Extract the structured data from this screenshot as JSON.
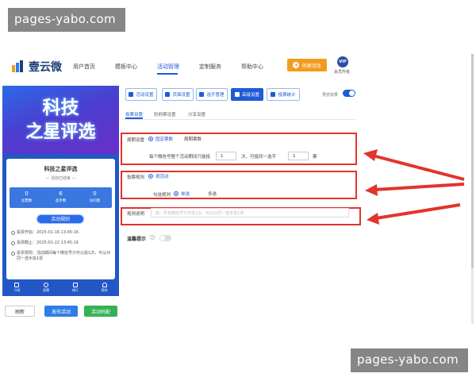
{
  "watermark": "pages-yabo.com",
  "nav": {
    "logo": "壹云微",
    "items": [
      "用户首页",
      "模板中心",
      "活动管理",
      "定制服务",
      "帮助中心"
    ],
    "active_index": 2,
    "create_button": "创建活动",
    "vip_badge": "VIP",
    "vip_label": "会员升级"
  },
  "preview": {
    "banner_line1": "科技",
    "banner_line2": "之星评选",
    "title": "科技之星评选",
    "status": "— 活动已结束 —",
    "stats": [
      {
        "num": "0",
        "label": "总票数"
      },
      {
        "num": "6",
        "label": "选手数"
      },
      {
        "num": "0",
        "label": "访问量"
      }
    ],
    "rules_button": "活动规则",
    "info": [
      "投票开始：2025-01-16 13:45:16",
      "投票截止：2025-01-22 13:45:16",
      "投票规则：活动期间每个微信号只可以投1次，可以对同一选手投1票"
    ],
    "tabs": [
      "介绍",
      "投票",
      "排行",
      "我的"
    ]
  },
  "bottom_buttons": {
    "refresh": "刷新",
    "publish": "发布活动",
    "qr": "活动码配"
  },
  "toolbar": {
    "buttons": [
      "活动设置",
      "页面设置",
      "选手管理",
      "高级设置",
      "投票统计"
    ],
    "active_index": 3,
    "preview_label": "预览效果",
    "preview_on": true
  },
  "subtabs": [
    "投票设置",
    "防刷票设置",
    "分享设置"
  ],
  "form": {
    "cycle_label": "周期设置",
    "cycle_options": [
      "固定票数",
      "周期票数"
    ],
    "cycle_sentence_before": "每个微信号整个活动期间只能投",
    "cycle_value1": "1",
    "cycle_sentence_mid": "次，可投同一选手",
    "cycle_value2": "1",
    "cycle_sentence_after": "票",
    "vote_rule_label": "投票规则",
    "vote_rule_option": "按活动",
    "check_rule_label": "勾选规则",
    "check_options": [
      "单选",
      "多选"
    ],
    "rule_desc_label": "规则说明",
    "rule_desc_placeholder": "如：所有微信号只可投1次，可以对同一选手投1票",
    "tip_label": "温馨提示",
    "tip_enabled": false
  },
  "accent_colors": {
    "primary": "#1f5bd6",
    "orange": "#f29c1f",
    "green": "#35b256",
    "highlight": "#e1342d"
  }
}
